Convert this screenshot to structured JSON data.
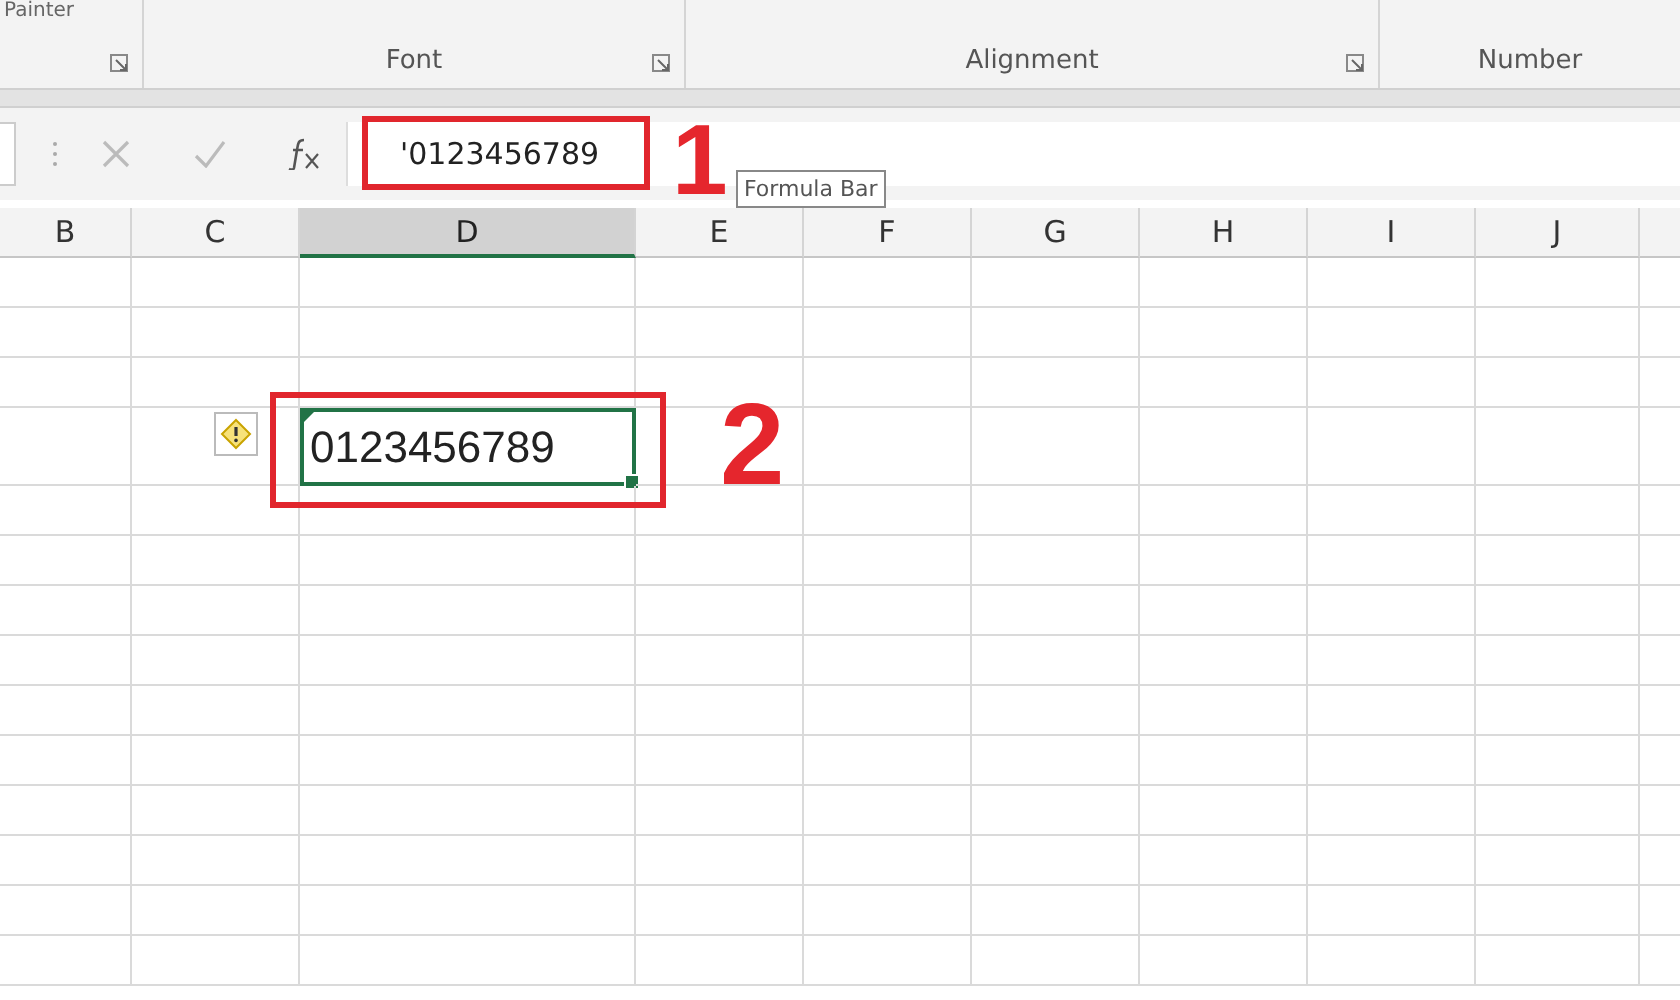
{
  "ribbon": {
    "clipped_label": "Painter",
    "groups": [
      {
        "launcher": true
      },
      {
        "label": "Font",
        "launcher": true
      },
      {
        "label": "Alignment",
        "launcher": true
      },
      {
        "label": "Number",
        "launcher": false
      }
    ]
  },
  "formula_bar": {
    "value": "'0123456789",
    "tooltip": "Formula Bar"
  },
  "grid": {
    "columns": [
      {
        "label": "B",
        "selected": false
      },
      {
        "label": "C",
        "selected": false
      },
      {
        "label": "D",
        "selected": true
      },
      {
        "label": "E",
        "selected": false
      },
      {
        "label": "F",
        "selected": false
      },
      {
        "label": "G",
        "selected": false
      },
      {
        "label": "H",
        "selected": false
      },
      {
        "label": "I",
        "selected": false
      },
      {
        "label": "J",
        "selected": false
      }
    ],
    "active_cell": {
      "value": "0123456789",
      "warning": true
    }
  },
  "annotations": [
    {
      "label": "1"
    },
    {
      "label": "2"
    }
  ]
}
